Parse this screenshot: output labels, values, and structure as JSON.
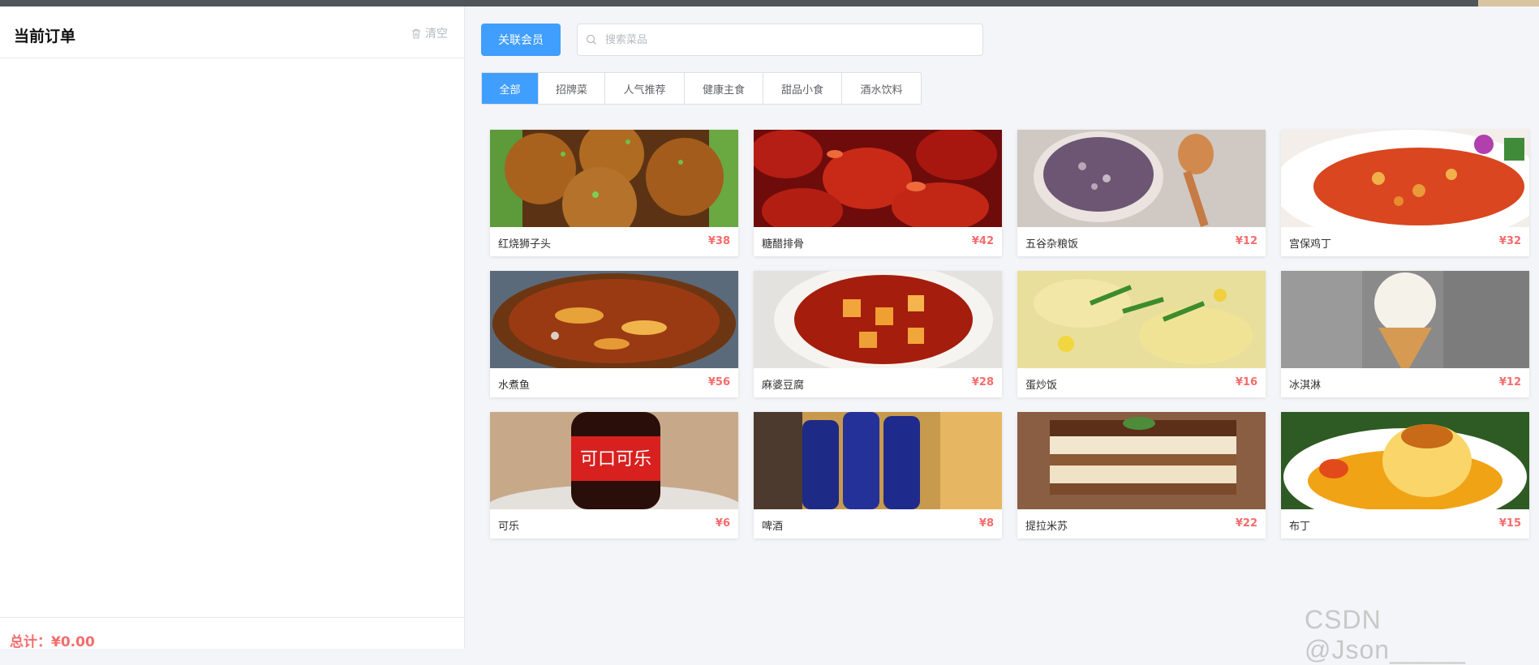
{
  "order": {
    "title": "当前订单",
    "clear_label": "清空",
    "total_label": "总计：",
    "total_value": "¥0.00"
  },
  "toolbar": {
    "member_button": "关联会员",
    "search_placeholder": "搜索菜品"
  },
  "tabs": [
    {
      "label": "全部",
      "active": true
    },
    {
      "label": "招牌菜",
      "active": false
    },
    {
      "label": "人气推荐",
      "active": false
    },
    {
      "label": "健康主食",
      "active": false
    },
    {
      "label": "甜品小食",
      "active": false
    },
    {
      "label": "酒水饮料",
      "active": false
    }
  ],
  "dishes": [
    {
      "name": "红烧狮子头",
      "price": "¥38"
    },
    {
      "name": "糖醋排骨",
      "price": "¥42"
    },
    {
      "name": "五谷杂粮饭",
      "price": "¥12"
    },
    {
      "name": "宫保鸡丁",
      "price": "¥32"
    },
    {
      "name": "水煮鱼",
      "price": "¥56"
    },
    {
      "name": "麻婆豆腐",
      "price": "¥28"
    },
    {
      "name": "蛋炒饭",
      "price": "¥16"
    },
    {
      "name": "冰淇淋",
      "price": "¥12"
    },
    {
      "name": "可乐",
      "price": "¥6"
    },
    {
      "name": "啤酒",
      "price": "¥8"
    },
    {
      "name": "提拉米苏",
      "price": "¥22"
    },
    {
      "name": "布丁",
      "price": "¥15"
    }
  ],
  "watermark": "CSDN @Json_____"
}
